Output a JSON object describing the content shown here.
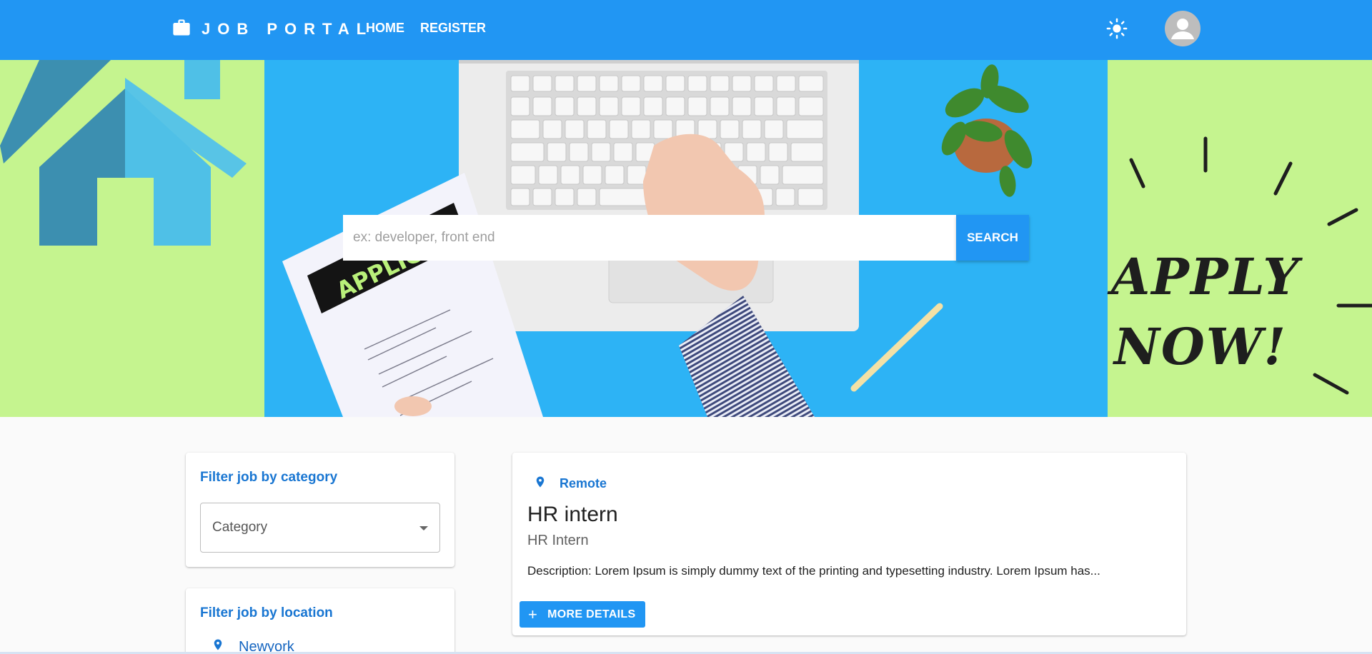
{
  "navbar": {
    "brand": "JOB PORTAL",
    "links": [
      "HOME",
      "REGISTER"
    ],
    "icons": {
      "brand": "briefcase-icon",
      "theme": "sun-icon",
      "avatar": "account-circle-icon"
    },
    "color": "#2196f3"
  },
  "hero": {
    "apply_line1": "APPLY",
    "apply_line2": "NOW!",
    "paper_label": "APPLICA",
    "search": {
      "placeholder": "ex: developer, front end",
      "button": "SEARCH"
    },
    "colors": {
      "side": "#c5f48f",
      "center": "#2db3f5"
    }
  },
  "filters": {
    "category": {
      "title": "Filter job by category",
      "select_value": "Category"
    },
    "location": {
      "title": "Filter job by location",
      "items": [
        "Newyork"
      ]
    }
  },
  "job": {
    "location": "Remote",
    "title": "HR intern",
    "subtitle": "HR Intern",
    "description": "Description: Lorem Ipsum is simply dummy text of the printing and typesetting industry. Lorem Ipsum has...",
    "button": "MORE DETAILS"
  },
  "accent": "#1976d2"
}
